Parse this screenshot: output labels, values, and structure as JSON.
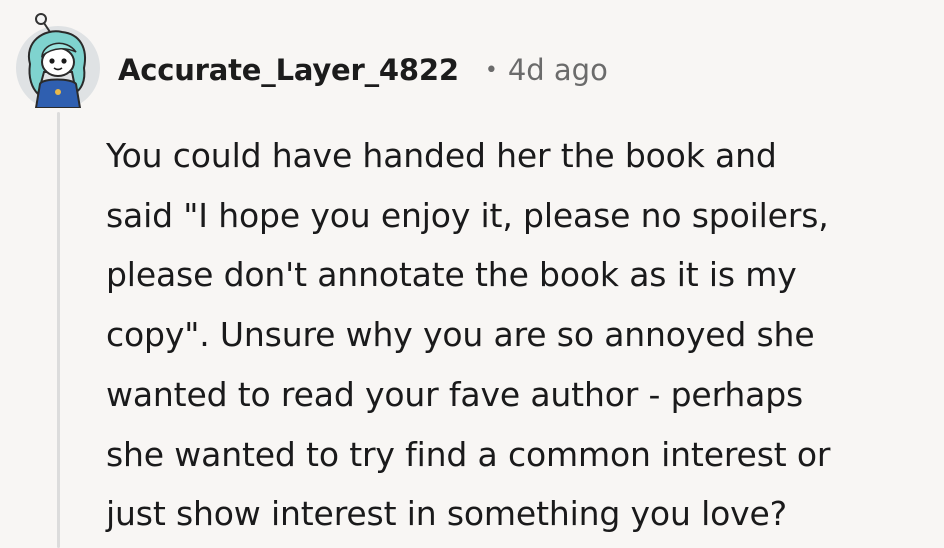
{
  "comment": {
    "author": "Accurate_Layer_4822",
    "separator": "•",
    "timestamp": "4d ago",
    "avatar_icon": "snoo-avatar-icon",
    "body_lines": [
      "You could have handed her the book and",
      "said \"I hope you enjoy it, please no spoilers,",
      "please don't annotate the book as it is my",
      "copy\". Unsure why you are so annoyed she",
      "wanted to read your fave author - perhaps",
      "she wanted to try find a common interest or",
      "just show interest in something you love?"
    ]
  },
  "colors": {
    "background": "#f8f6f4",
    "text": "#1a1a1b",
    "meta": "#6b6b6b",
    "thread_line": "#dcdcdc",
    "avatar_bg": "#dfe2e4",
    "avatar_hair": "#7fd3cf",
    "avatar_body": "#2f5fb0"
  }
}
